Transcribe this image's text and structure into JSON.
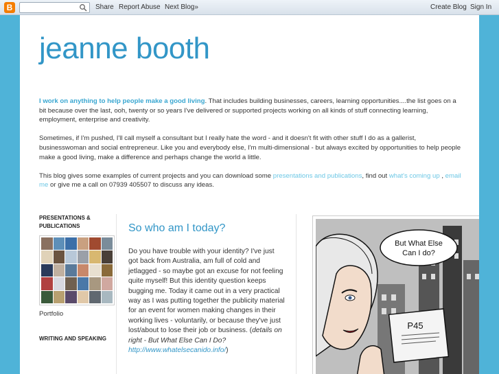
{
  "navbar": {
    "logo": "B",
    "search_placeholder": "",
    "share": "Share",
    "report_abuse": "Report Abuse",
    "next_blog": "Next Blog»",
    "create_blog": "Create Blog",
    "sign_in": "Sign In"
  },
  "blog": {
    "title": "jeanne booth"
  },
  "description": {
    "p1_highlight": "I work on anything to help people make a good living",
    "p1_rest": ". That includes building businesses, careers, learning opportunities....the list goes on a bit because over the last, ooh, twenty or so years I've delivered or supported projects working on all kinds of stuff connecting learning, employment, enterprise and creativity.",
    "p2": "Sometimes, if I'm pushed, I'll call myself a consultant but I really hate the word - and it doesn't fit with other stuff I do as a gallerist, businesswoman and social entrepreneur. Like you and everybody else, I'm multi-dimensional - but always excited by opportunities to help people make a good living, make a difference and perhaps change the world a little.",
    "p3_a": "This blog gives some examples of current projects and you can download some ",
    "p3_link1": "presentations and publications",
    "p3_b": ", find out ",
    "p3_link2": "what's coming up",
    "p3_c": " , ",
    "p3_link3": "email me",
    "p3_d": " or give me a call on 07939 405507 to discuss any ideas."
  },
  "sidebar": {
    "heading1": "PRESENTATIONS & PUBLICATIONS",
    "caption": "Portfolio",
    "heading2": "WRITING AND SPEAKING"
  },
  "post": {
    "title": "So who am I today?",
    "body_main": "Do you have trouble with your identity? I've just got back from Australia, am full of cold and jetlagged - so maybe got an excuse for not feeling quite myself! But this identity question keeps bugging me. Today it came out in a very practical way as I was putting together the publicity material for an event for women making changes in their working lives - voluntarily, or because they've just lost/about to lose their job or business. (",
    "body_em": "details on right - But What Else Can I Do?",
    "body_link": "http://www.whatelsecanido.info/",
    "body_end": ")"
  },
  "comic": {
    "bubble_line1": "But What Else",
    "bubble_line2": "Can I do?",
    "card_label": "P45"
  },
  "colors": {
    "background": "#4fb3d8",
    "title": "#3296c7",
    "link": "#6cc7e5",
    "highlight": "#3aa7d1"
  }
}
